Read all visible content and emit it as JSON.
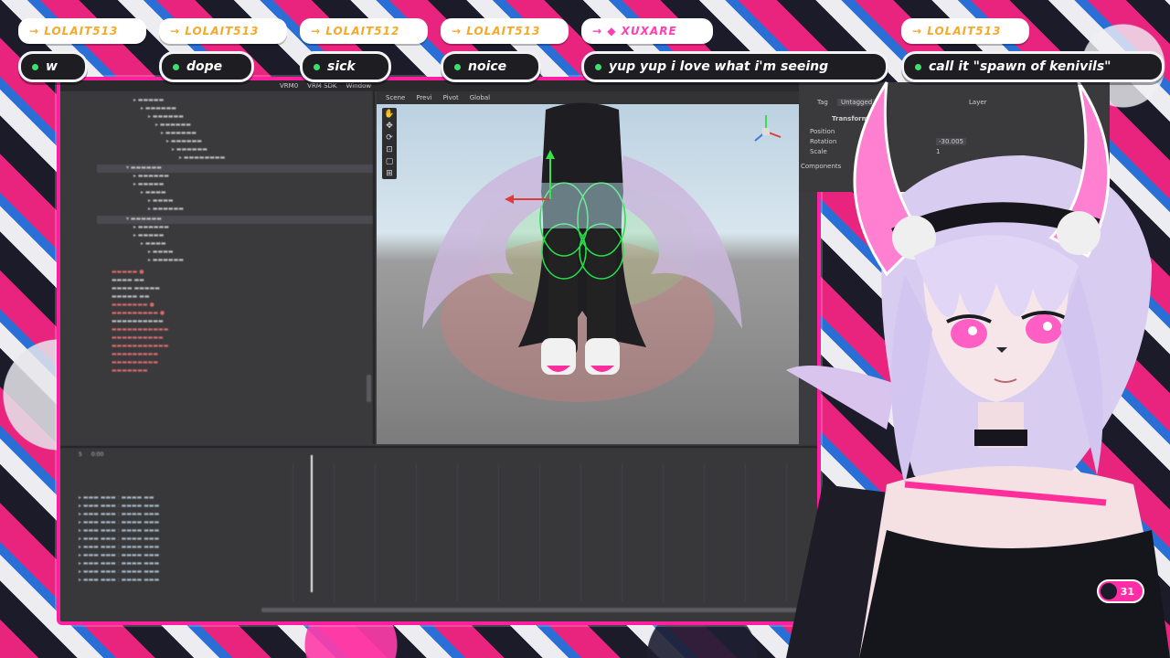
{
  "editor": {
    "menu": [
      "VRM0",
      "VRM SDK",
      "Window"
    ],
    "scene_tabs": [
      "Scene",
      "Previ",
      "Pivot",
      "Global"
    ],
    "timeline": {
      "start_value": "0:00",
      "frame_value": "5"
    }
  },
  "inspector": {
    "tag_label": "Tag",
    "tag_value": "Untagged",
    "layer_label": "Layer",
    "transform_title": "Transform",
    "position_label": "Position",
    "rotation_label": "Rotation",
    "scale_label": "Scale",
    "rotation_x_value": "-30.005",
    "scale_x_value": "1",
    "components_label": "Components"
  },
  "chat": {
    "names": [
      {
        "text": "LOLAIT513",
        "color": "#f4a928"
      },
      {
        "text": "LOLAIT513",
        "color": "#f4a928"
      },
      {
        "text": "LOLAIT512",
        "color": "#f4a928"
      },
      {
        "text": "LOLAIT513",
        "color": "#f4a928"
      },
      {
        "text": "XUXARE",
        "color": "#ff3fb2"
      },
      {
        "text": "LOLAIT513",
        "color": "#f4a928"
      }
    ],
    "messages": [
      "w",
      "dope",
      "sick",
      "noice",
      "yup yup i love what i'm seeing",
      "call it \"spawn of kenivils\""
    ]
  },
  "counter": {
    "value": "31"
  },
  "colors": {
    "accent_pink": "#ff1fa0",
    "online_green": "#39e36b"
  }
}
